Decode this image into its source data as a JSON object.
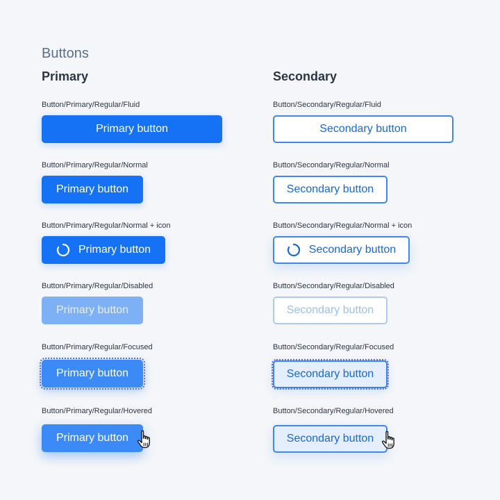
{
  "page": {
    "title": "Buttons"
  },
  "primary": {
    "heading": "Primary",
    "fluid": {
      "label": "Button/Primary/Regular/Fluid",
      "text": "Primary button"
    },
    "normal": {
      "label": "Button/Primary/Regular/Normal",
      "text": "Primary button"
    },
    "normal_icon": {
      "label": "Button/Primary/Regular/Normal + icon",
      "text": "Primary button",
      "icon": "spinner-icon"
    },
    "disabled": {
      "label": "Button/Primary/Regular/Disabled",
      "text": "Primary button"
    },
    "focused": {
      "label": "Button/Primary/Regular/Focused",
      "text": "Primary button"
    },
    "hovered": {
      "label": "Button/Primary/Regular/Hovered",
      "text": "Primary button",
      "cursor": "hand-pointer-icon"
    }
  },
  "secondary": {
    "heading": "Secondary",
    "fluid": {
      "label": "Button/Secondary/Regular/Fluid",
      "text": "Secondary button"
    },
    "normal": {
      "label": "Button/Secondary/Regular/Normal",
      "text": "Secondary button"
    },
    "normal_icon": {
      "label": "Button/Secondary/Regular/Normal + icon",
      "text": "Secondary button",
      "icon": "spinner-icon"
    },
    "disabled": {
      "label": "Button/Secondary/Regular/Disabled",
      "text": "Secondary button"
    },
    "focused": {
      "label": "Button/Secondary/Regular/Focused",
      "text": "Secondary button"
    },
    "hovered": {
      "label": "Button/Secondary/Regular/Hovered",
      "text": "Secondary button",
      "cursor": "hand-pointer-icon"
    }
  },
  "colors": {
    "background": "#f4f6f9",
    "primary": "#1672f4",
    "primary_disabled": "#7eb0f6",
    "primary_hover": "#3b8af6",
    "secondary_border": "#3d87ee",
    "secondary_text": "#1468d9",
    "focus_outline": "#5a68e0",
    "title": "#5a6e8c",
    "text": "#2c3544"
  }
}
